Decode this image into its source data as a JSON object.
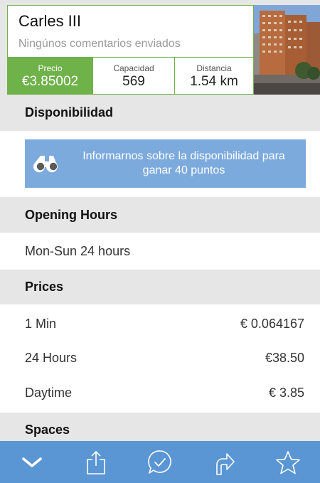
{
  "header": {
    "title": "Carles III",
    "subtitle": "Ningúnos comentarios enviados",
    "stats": {
      "price_label": "Precio",
      "price_value": "€3.85002",
      "capacity_label": "Capacidad",
      "capacity_value": "569",
      "distance_label": "Distancia",
      "distance_value": "1.54 km"
    }
  },
  "availability": {
    "title": "Disponibilidad",
    "button_text": "Informarnos sobre la disponibilidad para ganar 40 puntos"
  },
  "opening_hours": {
    "title": "Opening Hours",
    "value": "Mon-Sun 24 hours"
  },
  "prices": {
    "title": "Prices",
    "items": [
      {
        "label": "1 Min",
        "value": "€ 0.064167"
      },
      {
        "label": "24 Hours",
        "value": "€38.50"
      },
      {
        "label": "Daytime",
        "value": "€ 3.85"
      }
    ]
  },
  "spaces": {
    "title": "Spaces"
  },
  "colors": {
    "accent_green": "#6fb24a",
    "button_blue": "#7caadd",
    "tabbar_blue": "#5b96d4",
    "section_gray": "#e6e6e6"
  },
  "tabbar": {
    "icons": [
      "chevron-down-icon",
      "share-icon",
      "checkin-icon",
      "directions-icon",
      "star-icon"
    ]
  }
}
